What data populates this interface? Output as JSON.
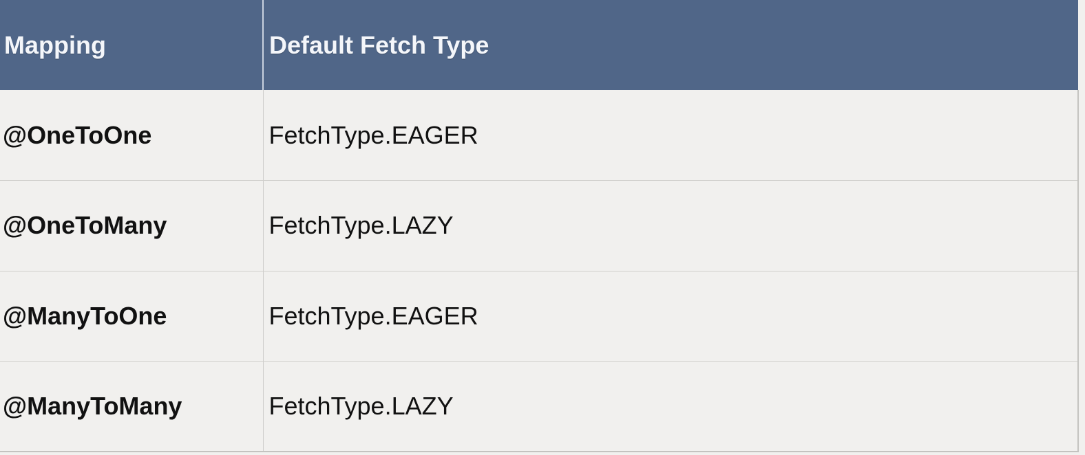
{
  "table": {
    "headers": {
      "mapping": "Mapping",
      "fetch_type": "Default Fetch Type"
    },
    "rows": [
      {
        "mapping": "@OneToOne",
        "fetch_type": "FetchType.EAGER"
      },
      {
        "mapping": "@OneToMany",
        "fetch_type": "FetchType.LAZY"
      },
      {
        "mapping": "@ManyToOne",
        "fetch_type": "FetchType.EAGER"
      },
      {
        "mapping": "@ManyToMany",
        "fetch_type": "FetchType.LAZY"
      }
    ]
  },
  "colors": {
    "header_background": "#506688",
    "header_text": "#f4f6fa",
    "body_background": "#f1f0ee",
    "body_text": "#111111",
    "grid_line": "#cfcecb"
  }
}
